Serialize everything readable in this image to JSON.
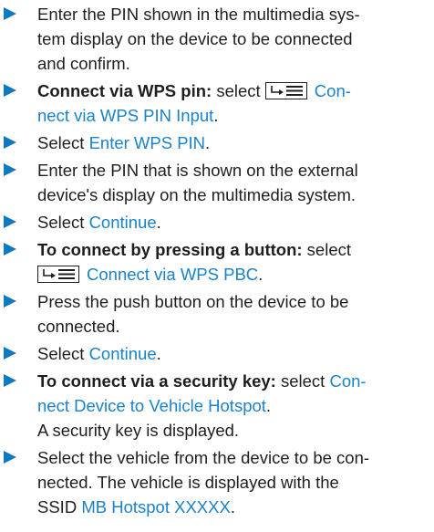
{
  "steps": [
    {
      "lines": [
        [
          {
            "t": "Enter the PIN shown in the multimedia sys-"
          }
        ],
        [
          {
            "t": "tem display on the device to be connected"
          }
        ],
        [
          {
            "t": "and confirm."
          }
        ]
      ]
    },
    {
      "lines": [
        [
          {
            "t": "Connect via WPS pin:",
            "s": "lead"
          },
          {
            "t": " select "
          },
          {
            "icon": "menu-icon"
          },
          {
            "t": "Con-",
            "s": "ui"
          }
        ],
        [
          {
            "t": "nect via WPS PIN Input",
            "s": "ui"
          },
          {
            "t": "."
          }
        ]
      ]
    },
    {
      "lines": [
        [
          {
            "t": "Select "
          },
          {
            "t": "Enter WPS PIN",
            "s": "ui"
          },
          {
            "t": "."
          }
        ]
      ]
    },
    {
      "lines": [
        [
          {
            "t": "Enter the PIN that is shown on the external"
          }
        ],
        [
          {
            "t": "device's display on the multimedia system."
          }
        ]
      ]
    },
    {
      "lines": [
        [
          {
            "t": "Select "
          },
          {
            "t": "Continue",
            "s": "ui"
          },
          {
            "t": "."
          }
        ]
      ]
    },
    {
      "lines": [
        [
          {
            "t": "To connect by pressing a button:",
            "s": "lead"
          },
          {
            "t": " select"
          }
        ],
        [
          {
            "icon": "menu-icon"
          },
          {
            "t": "Connect via WPS PBC",
            "s": "ui"
          },
          {
            "t": "."
          }
        ]
      ]
    },
    {
      "lines": [
        [
          {
            "t": "Press the push button on the device to be"
          }
        ],
        [
          {
            "t": "connected."
          }
        ]
      ]
    },
    {
      "lines": [
        [
          {
            "t": "Select "
          },
          {
            "t": "Continue",
            "s": "ui"
          },
          {
            "t": "."
          }
        ]
      ]
    },
    {
      "lines": [
        [
          {
            "t": "To connect via a security key:",
            "s": "lead"
          },
          {
            "t": " select "
          },
          {
            "t": "Con-",
            "s": "ui"
          }
        ],
        [
          {
            "t": "nect Device to Vehicle Hotspot",
            "s": "ui"
          },
          {
            "t": "."
          }
        ],
        [
          {
            "t": "A security key is displayed."
          }
        ]
      ]
    },
    {
      "lines": [
        [
          {
            "t": "Select the vehicle from the device to be con-"
          }
        ],
        [
          {
            "t": "nected. The vehicle is displayed with the"
          }
        ],
        [
          {
            "t": "SSID "
          },
          {
            "t": "MB Hotspot XXXXX",
            "s": "ui"
          },
          {
            "t": "."
          }
        ]
      ]
    }
  ],
  "colors": {
    "arrow": "#0f7ac2",
    "ui_text": "#1a82c8",
    "text": "#1e1e1e"
  }
}
